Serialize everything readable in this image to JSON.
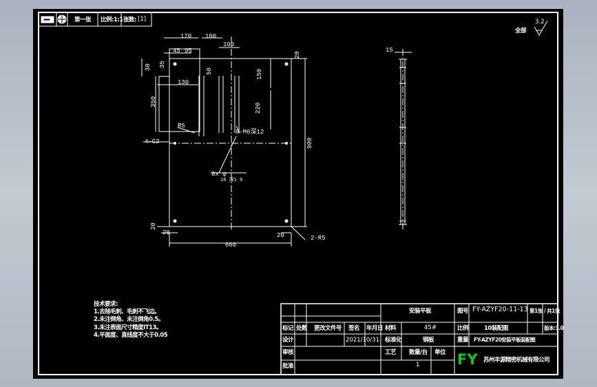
{
  "colors": {
    "paper": "#000000",
    "line": "#ffffff",
    "logo": "#13c51e",
    "frame": "#b3bcc6"
  },
  "header": {
    "icon1": "rect-slot-icon",
    "icon2": "target-icon",
    "sheet_no": "第一张",
    "ratio_label": "比例:1:1",
    "copies_label": "张数:",
    "copies_value": "[1]"
  },
  "surface": {
    "label": "全部",
    "symbol": "3.2"
  },
  "front_view": {
    "dims": {
      "d170": "170",
      "d100a": "100",
      "d100b": "100",
      "d45": "45",
      "d95": "95",
      "d30": "30",
      "d35": "35",
      "d130": "130",
      "d150": "150",
      "d50": "50",
      "d350": "350",
      "d220": "220",
      "d20_tr": "20",
      "d900": "900",
      "d20_bl": "20",
      "d20_b": "20",
      "d20_br": "20",
      "d660": "660"
    },
    "callouts": {
      "r5": "R5",
      "c2": "4-C2",
      "thread": "8-M6深12",
      "hole": "8x φ",
      "hole_sub": "10 深1 9",
      "r5b": "2-R5"
    }
  },
  "side_view": {
    "thickness": "15"
  },
  "notes": {
    "title": "技术要求:",
    "items": [
      "1.去除毛刺、毛刺不飞边。",
      "2.未注倒角、未注倒角0.5。",
      "3.未注表面尺寸精度IT13。",
      "4.平面度、直线度不大于0.05"
    ]
  },
  "title_block": {
    "part_name": "安装平板",
    "drawing_no": "FY-AZYF20-11-13",
    "sheet_of": "第1张 / 共1张",
    "material": "45#",
    "scale": "1:1",
    "scale_label": "比例",
    "weight_label": "重量",
    "date": "2021/10/31",
    "design": "设计",
    "check": "审核",
    "approve": "批准",
    "process": "工艺",
    "standard": "标准化",
    "rev_headers": [
      "标记",
      "处数",
      "更改文件号",
      "签名",
      "年月日"
    ],
    "qty_label": "数量/台",
    "qty": "1",
    "unit_label": "单位",
    "assembly_no": "10装配图",
    "assembly_name": "FY-AZYF20安装平板装配图",
    "version": "版本:1.0",
    "company": "苏州丰源精密机械有限公司",
    "logo": "FY",
    "weight": "钢板"
  }
}
